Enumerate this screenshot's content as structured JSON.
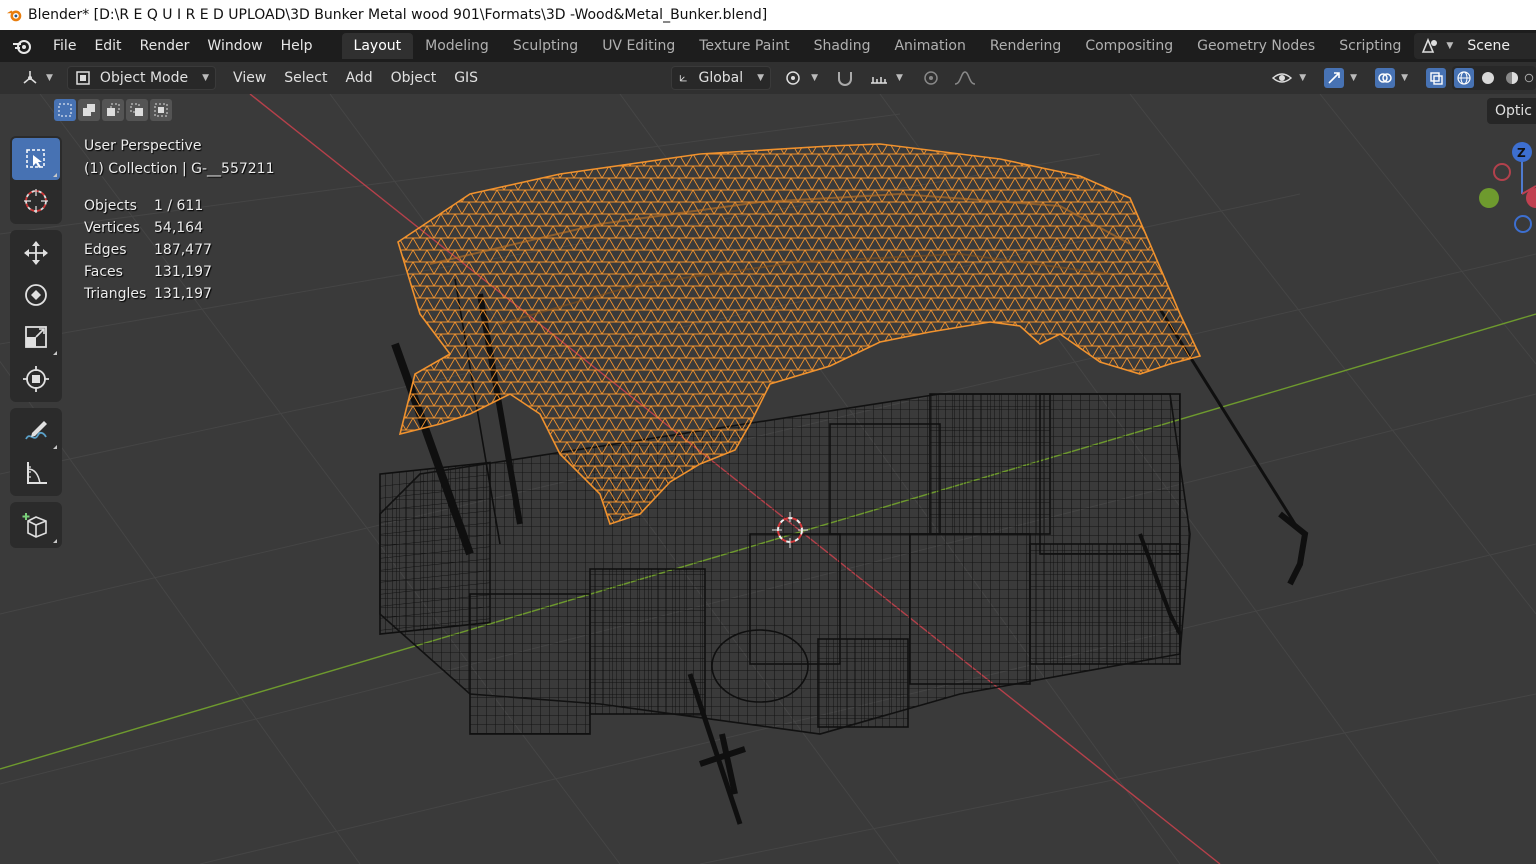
{
  "window": {
    "title": "Blender* [D:\\R E Q U I R E D   UPLOAD\\3D Bunker Metal wood 901\\Formats\\3D -Wood&Metal_Bunker.blend]"
  },
  "menu": [
    "File",
    "Edit",
    "Render",
    "Window",
    "Help"
  ],
  "workspaces": [
    {
      "label": "Layout",
      "active": true
    },
    {
      "label": "Modeling"
    },
    {
      "label": "Sculpting"
    },
    {
      "label": "UV Editing"
    },
    {
      "label": "Texture Paint"
    },
    {
      "label": "Shading"
    },
    {
      "label": "Animation"
    },
    {
      "label": "Rendering"
    },
    {
      "label": "Compositing"
    },
    {
      "label": "Geometry Nodes"
    },
    {
      "label": "Scripting"
    }
  ],
  "scene": {
    "label": "Scene"
  },
  "header": {
    "mode": "Object Mode",
    "menus": [
      "View",
      "Select",
      "Add",
      "Object",
      "GIS"
    ],
    "orientation": "Global",
    "options_label": "Optic"
  },
  "overlay": {
    "perspective": "User Perspective",
    "collection": "(1) Collection | G-__557211",
    "stats": [
      {
        "key": "Objects",
        "value": "1 / 611"
      },
      {
        "key": "Vertices",
        "value": "54,164"
      },
      {
        "key": "Edges",
        "value": "187,477"
      },
      {
        "key": "Faces",
        "value": "131,197"
      },
      {
        "key": "Triangles",
        "value": "131,197"
      }
    ]
  },
  "colors": {
    "selection_orange": "#f0922e",
    "active_blue": "#4772b3",
    "axis_x": "#b5404a",
    "axis_y": "#6e9a2e"
  },
  "gizmo": {
    "z_label": "Z"
  },
  "icons": [
    "blender-logo-icon",
    "select-box-icon",
    "cursor-icon",
    "move-icon",
    "rotate-icon",
    "scale-icon",
    "transform-icon",
    "annotate-icon",
    "measure-icon",
    "add-cube-icon"
  ]
}
